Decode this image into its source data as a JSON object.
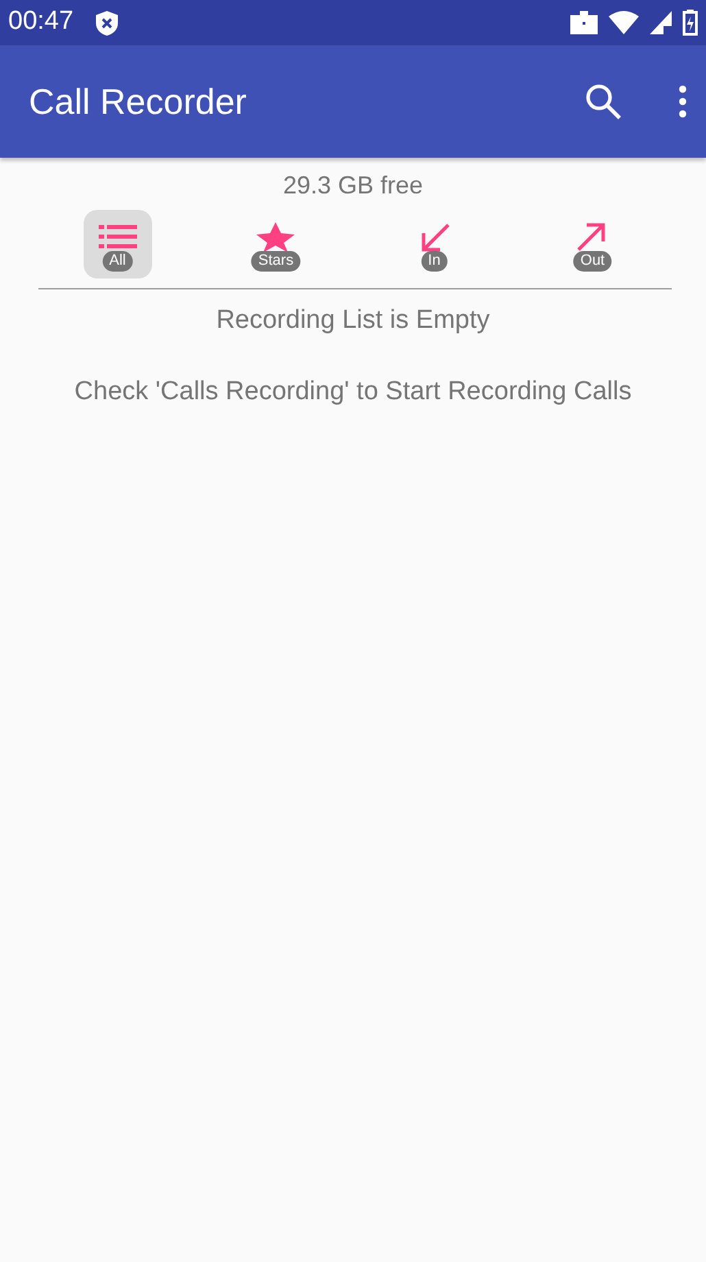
{
  "status_bar": {
    "time": "00:47"
  },
  "app_bar": {
    "title": "Call Recorder"
  },
  "storage": "29.3 GB free",
  "filters": [
    {
      "kind": "list",
      "label": "All",
      "selected": true
    },
    {
      "kind": "star",
      "label": "Stars",
      "selected": false
    },
    {
      "kind": "incoming",
      "label": "In",
      "selected": false
    },
    {
      "kind": "outgoing",
      "label": "Out",
      "selected": false
    }
  ],
  "empty_title": "Recording List is Empty",
  "empty_hint": "Check 'Calls Recording' to Start Recording Calls"
}
